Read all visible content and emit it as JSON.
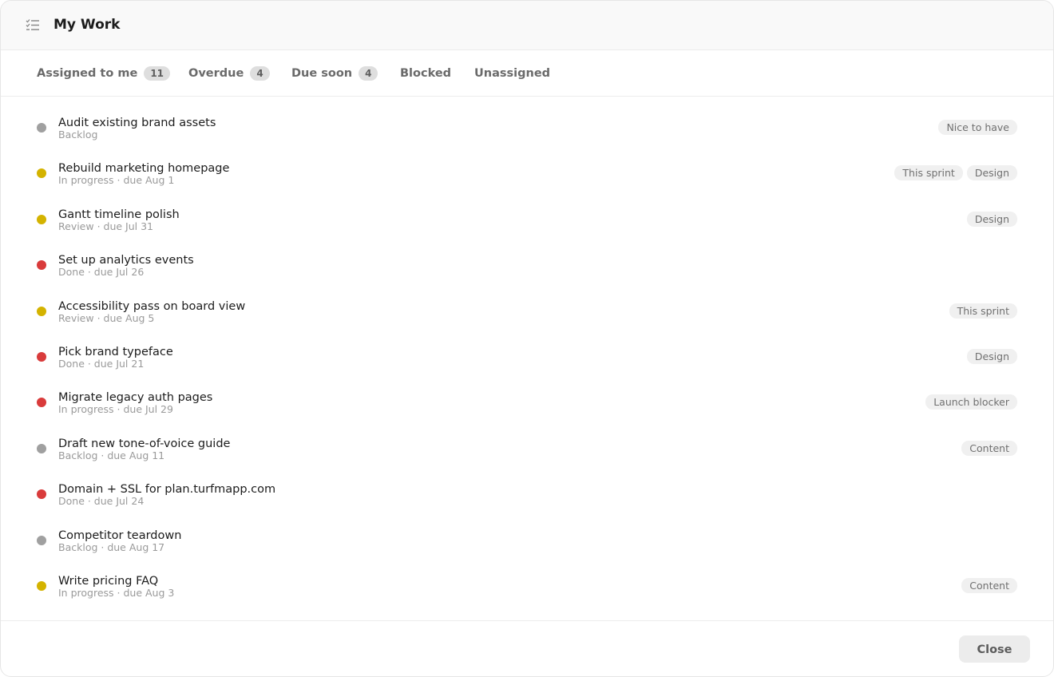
{
  "header": {
    "title": "My Work",
    "icon": "task-list-icon"
  },
  "tabs": [
    {
      "label": "Assigned to me",
      "count": "11"
    },
    {
      "label": "Overdue",
      "count": "4"
    },
    {
      "label": "Due soon",
      "count": "4"
    },
    {
      "label": "Blocked",
      "count": null
    },
    {
      "label": "Unassigned",
      "count": null
    }
  ],
  "colors": {
    "status_gray": "#a0a0a0",
    "status_yellow": "#d4b300",
    "status_red": "#d93b3b"
  },
  "tasks": [
    {
      "title": "Audit existing brand assets",
      "meta": "Backlog",
      "status_color": "#a0a0a0",
      "tags": [
        "Nice to have"
      ]
    },
    {
      "title": "Rebuild marketing homepage",
      "meta": "In progress · due Aug 1",
      "status_color": "#d4b300",
      "tags": [
        "This sprint",
        "Design"
      ]
    },
    {
      "title": "Gantt timeline polish",
      "meta": "Review · due Jul 31",
      "status_color": "#d4b300",
      "tags": [
        "Design"
      ]
    },
    {
      "title": "Set up analytics events",
      "meta": "Done · due Jul 26",
      "status_color": "#d93b3b",
      "tags": []
    },
    {
      "title": "Accessibility pass on board view",
      "meta": "Review · due Aug 5",
      "status_color": "#d4b300",
      "tags": [
        "This sprint"
      ]
    },
    {
      "title": "Pick brand typeface",
      "meta": "Done · due Jul 21",
      "status_color": "#d93b3b",
      "tags": [
        "Design"
      ]
    },
    {
      "title": "Migrate legacy auth pages",
      "meta": "In progress · due Jul 29",
      "status_color": "#d93b3b",
      "tags": [
        "Launch blocker"
      ]
    },
    {
      "title": "Draft new tone-of-voice guide",
      "meta": "Backlog · due Aug 11",
      "status_color": "#a0a0a0",
      "tags": [
        "Content"
      ]
    },
    {
      "title": "Domain + SSL for plan.turfmapp.com",
      "meta": "Done · due Jul 24",
      "status_color": "#d93b3b",
      "tags": []
    },
    {
      "title": "Competitor teardown",
      "meta": "Backlog · due Aug 17",
      "status_color": "#a0a0a0",
      "tags": []
    },
    {
      "title": "Write pricing FAQ",
      "meta": "In progress · due Aug 3",
      "status_color": "#d4b300",
      "tags": [
        "Content"
      ]
    }
  ],
  "footer": {
    "close_label": "Close"
  }
}
